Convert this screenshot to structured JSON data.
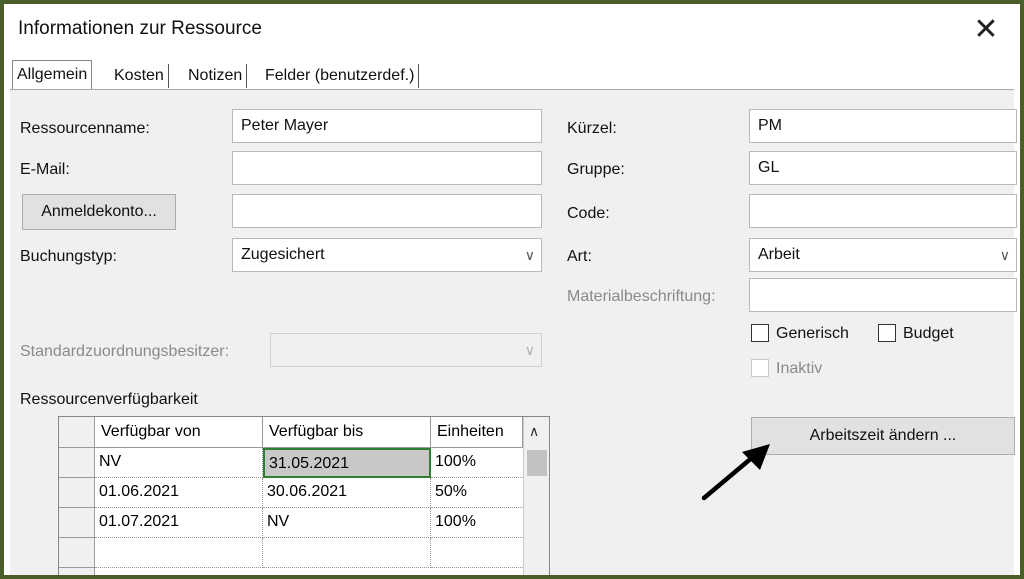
{
  "window": {
    "title": "Informationen zur Ressource",
    "close_symbol": "✕"
  },
  "tabs": [
    {
      "label": "Allgemein"
    },
    {
      "label": "Kosten"
    },
    {
      "label": "Notizen"
    },
    {
      "label": "Felder (benutzerdef.)"
    }
  ],
  "form": {
    "name_label": "Ressourcenname:",
    "name_value": "Peter Mayer",
    "email_label": "E-Mail:",
    "email_value": "",
    "login_button": "Anmeldekonto...",
    "login_value": "",
    "booking_label": "Buchungstyp:",
    "booking_value": "Zugesichert",
    "owner_label": "Standardzuordnungsbesitzer:",
    "owner_value": "",
    "short_label": "Kürzel:",
    "short_value": "PM",
    "group_label": "Gruppe:",
    "group_value": "GL",
    "code_label": "Code:",
    "code_value": "",
    "type_label": "Art:",
    "type_value": "Arbeit",
    "material_label": "Materialbeschriftung:",
    "material_value": "",
    "generic_label": "Generisch",
    "generic_checked": false,
    "budget_label": "Budget",
    "budget_checked": false,
    "inactive_label": "Inaktiv",
    "inactive_checked": false,
    "worktime_button": "Arbeitszeit ändern ..."
  },
  "availability": {
    "section_label": "Ressourcenverfügbarkeit",
    "columns": [
      "Verfügbar von",
      "Verfügbar bis",
      "Einheiten"
    ],
    "rows": [
      [
        "NV",
        "31.05.2021",
        "100%"
      ],
      [
        "01.06.2021",
        "30.06.2021",
        "50%"
      ],
      [
        "01.07.2021",
        "NV",
        "100%"
      ],
      [
        "",
        "",
        ""
      ]
    ]
  },
  "icons": {
    "close": "close-icon",
    "dropdown": "chevron-down-icon",
    "scroll_up": "chevron-up-icon",
    "arrow": "arrow-annotation-icon"
  },
  "colors": {
    "outer_border": "#4a5e2a",
    "selected_cell": "#c8c8c8",
    "selected_cell_border": "#2e7d32"
  }
}
